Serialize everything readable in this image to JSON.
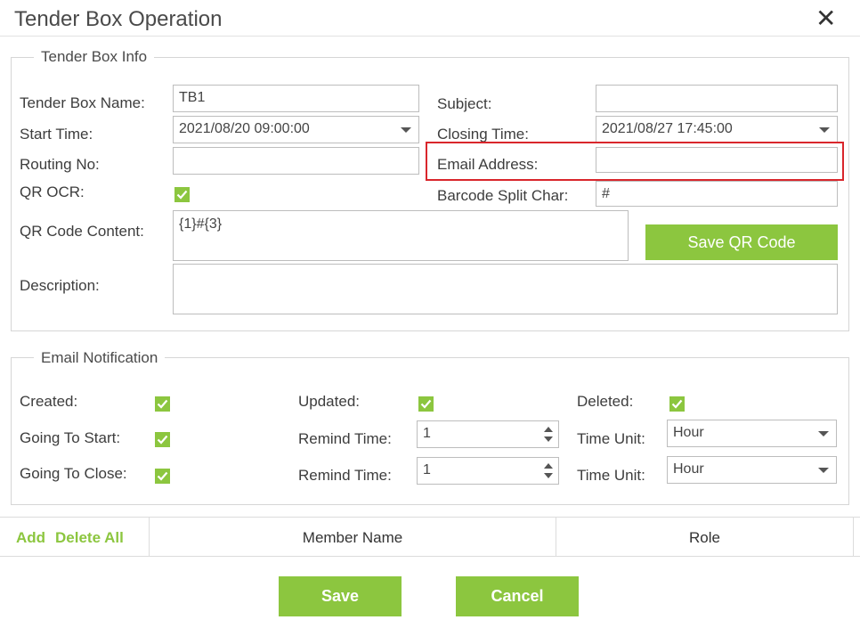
{
  "dialog": {
    "title": "Tender Box Operation",
    "close_glyph": "✕"
  },
  "info": {
    "legend": "Tender Box Info",
    "tender_box_name_label": "Tender Box Name:",
    "tender_box_name_value": "TB1",
    "start_time_label": "Start Time:",
    "start_time_value": "2021/08/20 09:00:00",
    "routing_no_label": "Routing No:",
    "routing_no_value": "",
    "qr_ocr_label": "QR OCR:",
    "qr_ocr_checked": true,
    "qr_code_content_label": "QR Code Content:",
    "qr_code_content_value": "{1}#{3}",
    "description_label": "Description:",
    "description_value": "",
    "subject_label": "Subject:",
    "subject_value": "",
    "closing_time_label": "Closing Time:",
    "closing_time_value": "2021/08/27 17:45:00",
    "email_address_label": "Email Address:",
    "email_address_value": "",
    "barcode_split_label": "Barcode Split Char:",
    "barcode_split_value": "#",
    "save_qr_label": "Save QR Code"
  },
  "notification": {
    "legend": "Email Notification",
    "created_label": "Created:",
    "updated_label": "Updated:",
    "deleted_label": "Deleted:",
    "going_to_start_label": "Going To Start:",
    "going_to_close_label": "Going To Close:",
    "remind_time_label": "Remind Time:",
    "remind_time_start_value": "1",
    "remind_time_close_value": "1",
    "time_unit_label": "Time Unit:",
    "time_unit_start_value": "Hour",
    "time_unit_close_value": "Hour"
  },
  "members": {
    "add_label": "Add",
    "delete_all_label": "Delete All",
    "col_member_name": "Member Name",
    "col_role": "Role"
  },
  "footer": {
    "save_label": "Save",
    "cancel_label": "Cancel"
  },
  "colors": {
    "accent_green": "#8cc63f",
    "highlight_red": "#d9262c"
  }
}
